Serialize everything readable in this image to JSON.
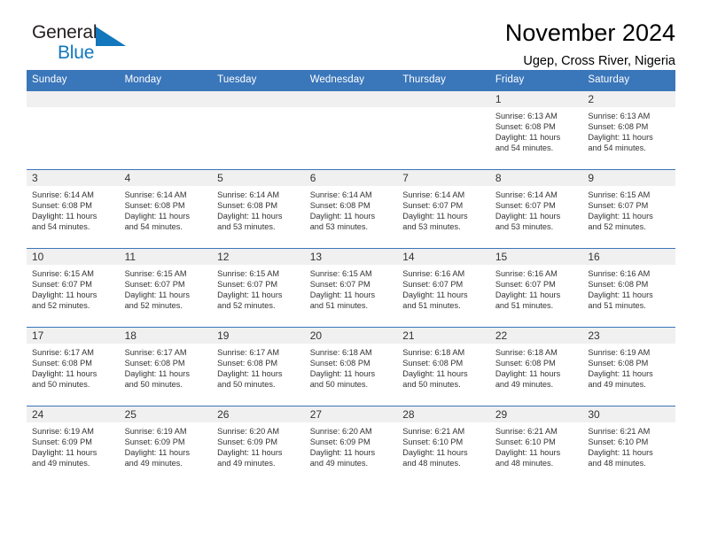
{
  "brand": {
    "word_one": "General",
    "word_two": "Blue",
    "triangle_icon": "triangle-icon",
    "accent_color": "#1277bd"
  },
  "header": {
    "title": "November 2024",
    "subtitle": "Ugep, Cross River, Nigeria"
  },
  "theme": {
    "header_blue": "#3a76ba",
    "daynum_band": "#f0f0f0",
    "text": "#333333"
  },
  "calendar": {
    "weekday_headers": [
      "Sunday",
      "Monday",
      "Tuesday",
      "Wednesday",
      "Thursday",
      "Friday",
      "Saturday"
    ],
    "labels": {
      "sunrise": "Sunrise:",
      "sunset": "Sunset:",
      "daylight": "Daylight:"
    },
    "weeks": [
      [
        {
          "day": "",
          "blank": true
        },
        {
          "day": "",
          "blank": true
        },
        {
          "day": "",
          "blank": true
        },
        {
          "day": "",
          "blank": true
        },
        {
          "day": "",
          "blank": true
        },
        {
          "day": "1",
          "sunrise": "Sunrise: 6:13 AM",
          "sunset": "Sunset: 6:08 PM",
          "daylight_1": "Daylight: 11 hours",
          "daylight_2": "and 54 minutes."
        },
        {
          "day": "2",
          "sunrise": "Sunrise: 6:13 AM",
          "sunset": "Sunset: 6:08 PM",
          "daylight_1": "Daylight: 11 hours",
          "daylight_2": "and 54 minutes."
        }
      ],
      [
        {
          "day": "3",
          "sunrise": "Sunrise: 6:14 AM",
          "sunset": "Sunset: 6:08 PM",
          "daylight_1": "Daylight: 11 hours",
          "daylight_2": "and 54 minutes."
        },
        {
          "day": "4",
          "sunrise": "Sunrise: 6:14 AM",
          "sunset": "Sunset: 6:08 PM",
          "daylight_1": "Daylight: 11 hours",
          "daylight_2": "and 54 minutes."
        },
        {
          "day": "5",
          "sunrise": "Sunrise: 6:14 AM",
          "sunset": "Sunset: 6:08 PM",
          "daylight_1": "Daylight: 11 hours",
          "daylight_2": "and 53 minutes."
        },
        {
          "day": "6",
          "sunrise": "Sunrise: 6:14 AM",
          "sunset": "Sunset: 6:08 PM",
          "daylight_1": "Daylight: 11 hours",
          "daylight_2": "and 53 minutes."
        },
        {
          "day": "7",
          "sunrise": "Sunrise: 6:14 AM",
          "sunset": "Sunset: 6:07 PM",
          "daylight_1": "Daylight: 11 hours",
          "daylight_2": "and 53 minutes."
        },
        {
          "day": "8",
          "sunrise": "Sunrise: 6:14 AM",
          "sunset": "Sunset: 6:07 PM",
          "daylight_1": "Daylight: 11 hours",
          "daylight_2": "and 53 minutes."
        },
        {
          "day": "9",
          "sunrise": "Sunrise: 6:15 AM",
          "sunset": "Sunset: 6:07 PM",
          "daylight_1": "Daylight: 11 hours",
          "daylight_2": "and 52 minutes."
        }
      ],
      [
        {
          "day": "10",
          "sunrise": "Sunrise: 6:15 AM",
          "sunset": "Sunset: 6:07 PM",
          "daylight_1": "Daylight: 11 hours",
          "daylight_2": "and 52 minutes."
        },
        {
          "day": "11",
          "sunrise": "Sunrise: 6:15 AM",
          "sunset": "Sunset: 6:07 PM",
          "daylight_1": "Daylight: 11 hours",
          "daylight_2": "and 52 minutes."
        },
        {
          "day": "12",
          "sunrise": "Sunrise: 6:15 AM",
          "sunset": "Sunset: 6:07 PM",
          "daylight_1": "Daylight: 11 hours",
          "daylight_2": "and 52 minutes."
        },
        {
          "day": "13",
          "sunrise": "Sunrise: 6:15 AM",
          "sunset": "Sunset: 6:07 PM",
          "daylight_1": "Daylight: 11 hours",
          "daylight_2": "and 51 minutes."
        },
        {
          "day": "14",
          "sunrise": "Sunrise: 6:16 AM",
          "sunset": "Sunset: 6:07 PM",
          "daylight_1": "Daylight: 11 hours",
          "daylight_2": "and 51 minutes."
        },
        {
          "day": "15",
          "sunrise": "Sunrise: 6:16 AM",
          "sunset": "Sunset: 6:07 PM",
          "daylight_1": "Daylight: 11 hours",
          "daylight_2": "and 51 minutes."
        },
        {
          "day": "16",
          "sunrise": "Sunrise: 6:16 AM",
          "sunset": "Sunset: 6:08 PM",
          "daylight_1": "Daylight: 11 hours",
          "daylight_2": "and 51 minutes."
        }
      ],
      [
        {
          "day": "17",
          "sunrise": "Sunrise: 6:17 AM",
          "sunset": "Sunset: 6:08 PM",
          "daylight_1": "Daylight: 11 hours",
          "daylight_2": "and 50 minutes."
        },
        {
          "day": "18",
          "sunrise": "Sunrise: 6:17 AM",
          "sunset": "Sunset: 6:08 PM",
          "daylight_1": "Daylight: 11 hours",
          "daylight_2": "and 50 minutes."
        },
        {
          "day": "19",
          "sunrise": "Sunrise: 6:17 AM",
          "sunset": "Sunset: 6:08 PM",
          "daylight_1": "Daylight: 11 hours",
          "daylight_2": "and 50 minutes."
        },
        {
          "day": "20",
          "sunrise": "Sunrise: 6:18 AM",
          "sunset": "Sunset: 6:08 PM",
          "daylight_1": "Daylight: 11 hours",
          "daylight_2": "and 50 minutes."
        },
        {
          "day": "21",
          "sunrise": "Sunrise: 6:18 AM",
          "sunset": "Sunset: 6:08 PM",
          "daylight_1": "Daylight: 11 hours",
          "daylight_2": "and 50 minutes."
        },
        {
          "day": "22",
          "sunrise": "Sunrise: 6:18 AM",
          "sunset": "Sunset: 6:08 PM",
          "daylight_1": "Daylight: 11 hours",
          "daylight_2": "and 49 minutes."
        },
        {
          "day": "23",
          "sunrise": "Sunrise: 6:19 AM",
          "sunset": "Sunset: 6:08 PM",
          "daylight_1": "Daylight: 11 hours",
          "daylight_2": "and 49 minutes."
        }
      ],
      [
        {
          "day": "24",
          "sunrise": "Sunrise: 6:19 AM",
          "sunset": "Sunset: 6:09 PM",
          "daylight_1": "Daylight: 11 hours",
          "daylight_2": "and 49 minutes."
        },
        {
          "day": "25",
          "sunrise": "Sunrise: 6:19 AM",
          "sunset": "Sunset: 6:09 PM",
          "daylight_1": "Daylight: 11 hours",
          "daylight_2": "and 49 minutes."
        },
        {
          "day": "26",
          "sunrise": "Sunrise: 6:20 AM",
          "sunset": "Sunset: 6:09 PM",
          "daylight_1": "Daylight: 11 hours",
          "daylight_2": "and 49 minutes."
        },
        {
          "day": "27",
          "sunrise": "Sunrise: 6:20 AM",
          "sunset": "Sunset: 6:09 PM",
          "daylight_1": "Daylight: 11 hours",
          "daylight_2": "and 49 minutes."
        },
        {
          "day": "28",
          "sunrise": "Sunrise: 6:21 AM",
          "sunset": "Sunset: 6:10 PM",
          "daylight_1": "Daylight: 11 hours",
          "daylight_2": "and 48 minutes."
        },
        {
          "day": "29",
          "sunrise": "Sunrise: 6:21 AM",
          "sunset": "Sunset: 6:10 PM",
          "daylight_1": "Daylight: 11 hours",
          "daylight_2": "and 48 minutes."
        },
        {
          "day": "30",
          "sunrise": "Sunrise: 6:21 AM",
          "sunset": "Sunset: 6:10 PM",
          "daylight_1": "Daylight: 11 hours",
          "daylight_2": "and 48 minutes."
        }
      ]
    ]
  }
}
